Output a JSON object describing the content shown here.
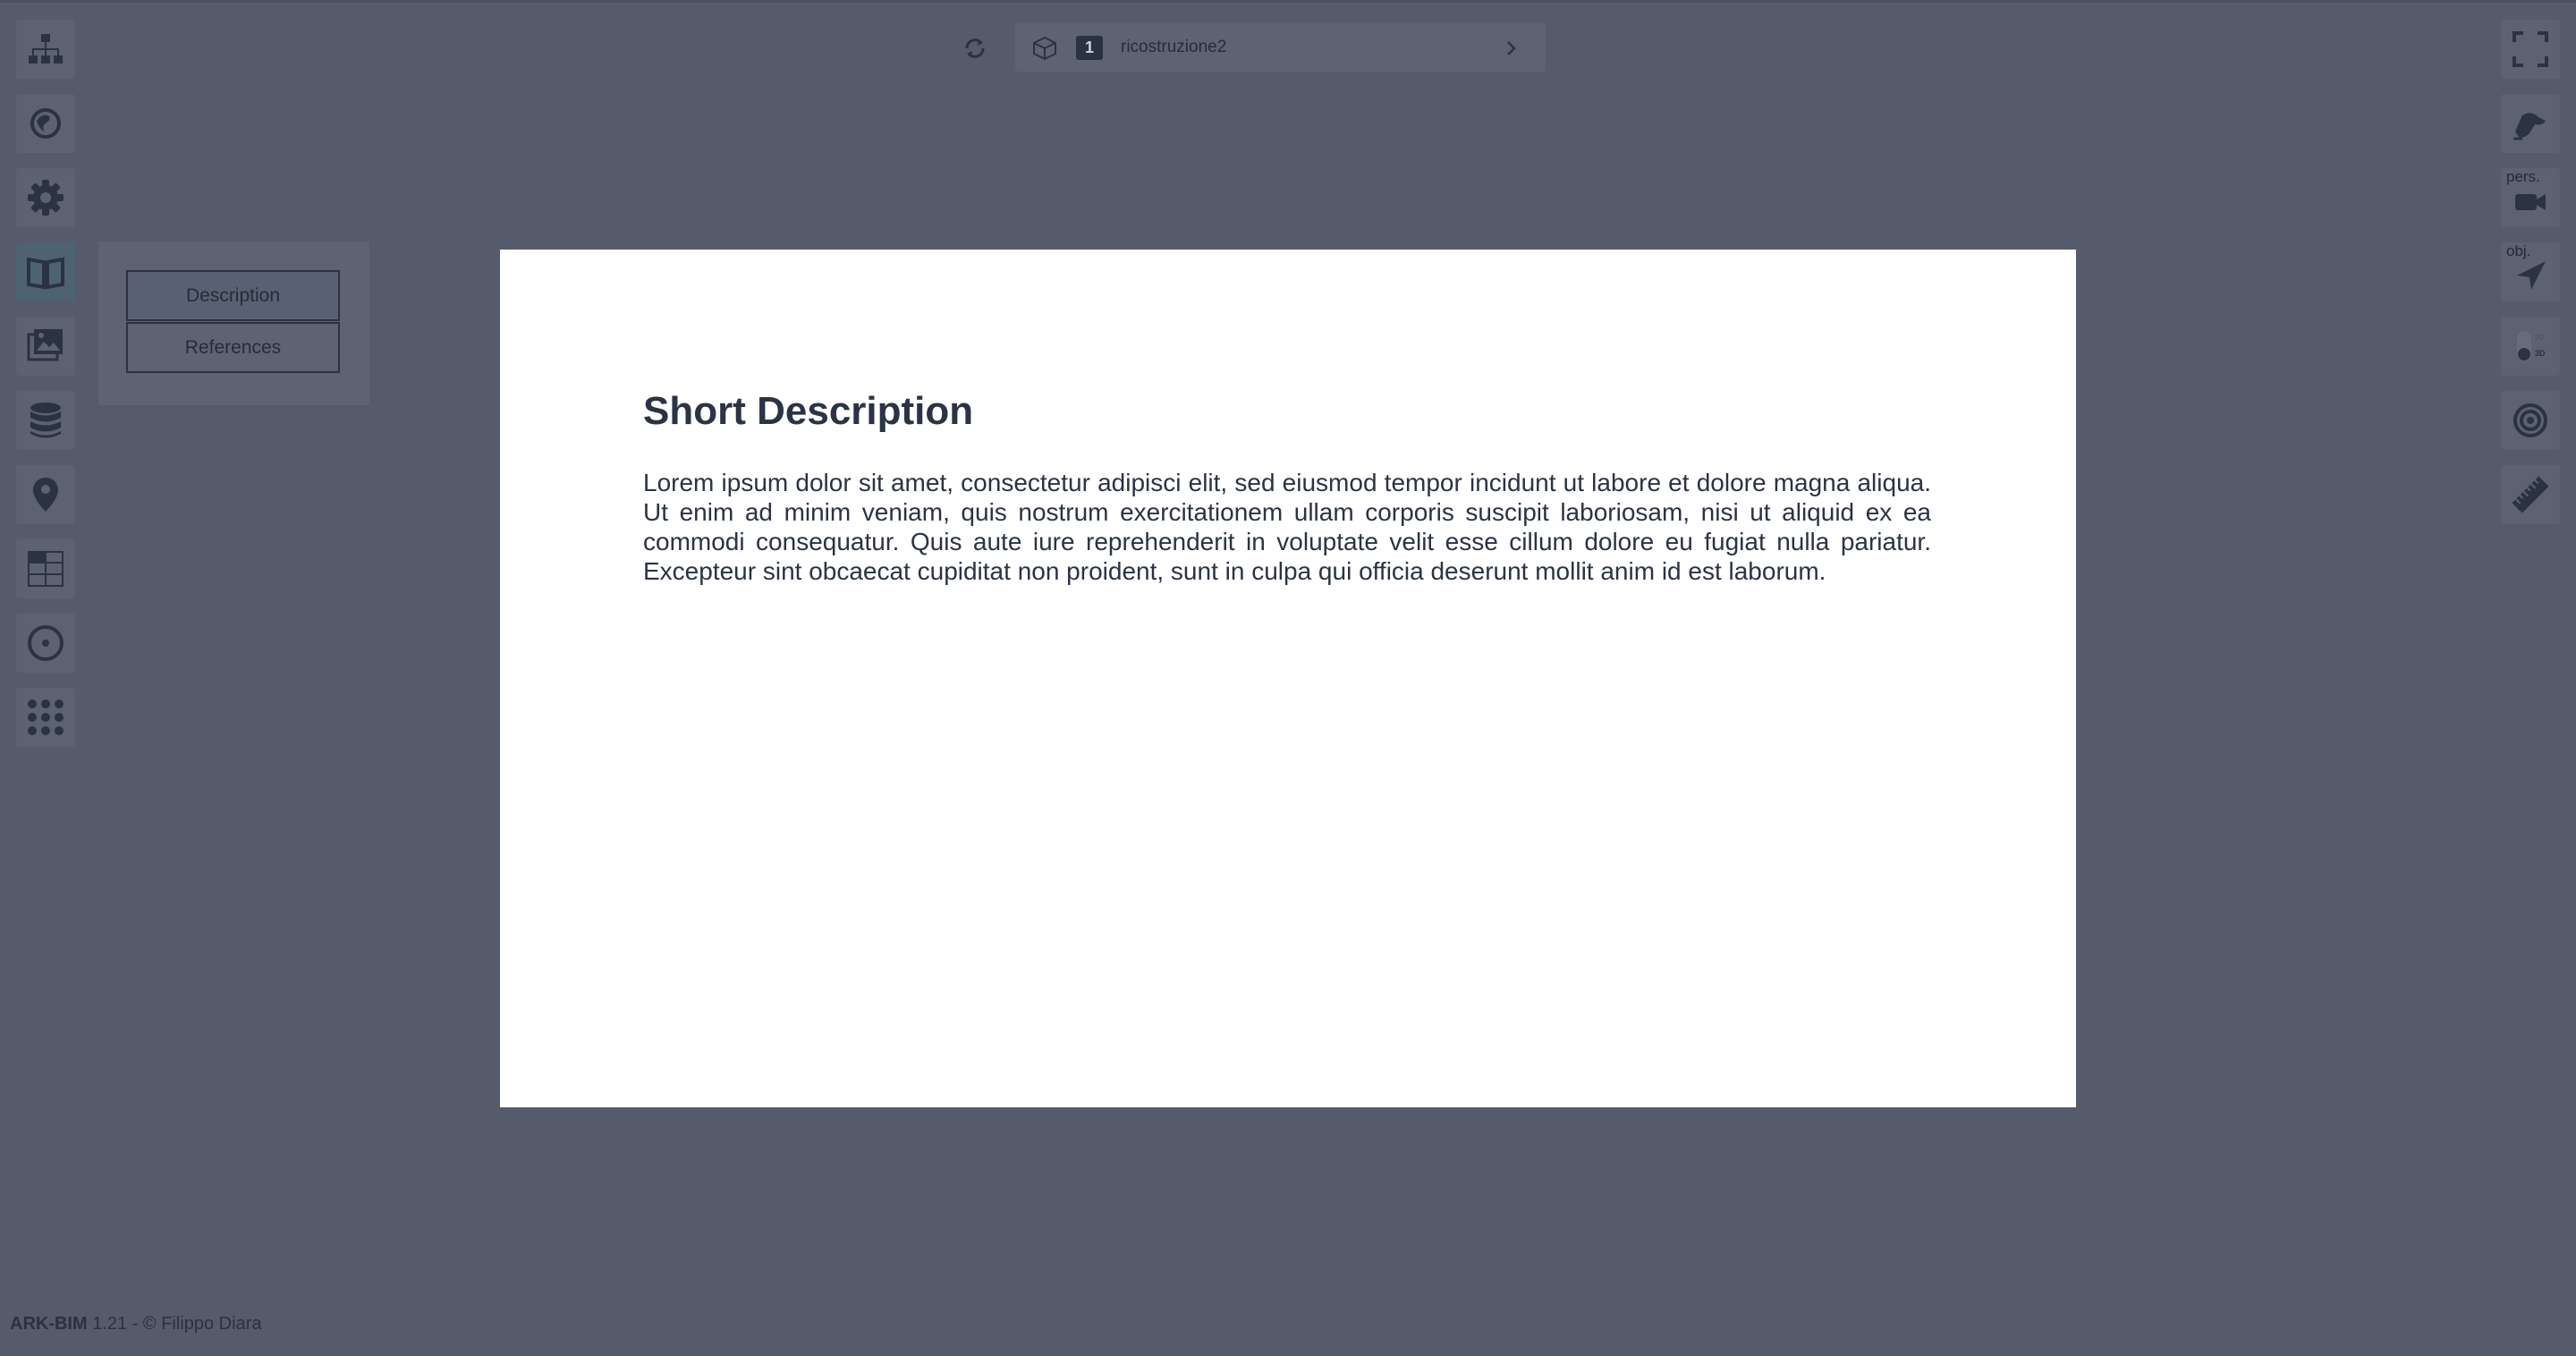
{
  "top_bar": {
    "model_index": "1",
    "model_name": "ricostruzione2"
  },
  "left_toolbar": {
    "items": [
      {
        "icon": "hierarchy-icon"
      },
      {
        "icon": "globe-icon"
      },
      {
        "icon": "gear-icon"
      },
      {
        "icon": "book-icon",
        "active": true
      },
      {
        "icon": "images-icon"
      },
      {
        "icon": "database-icon"
      },
      {
        "icon": "location-pin-icon"
      },
      {
        "icon": "table-icon"
      },
      {
        "icon": "target-dot-icon"
      },
      {
        "icon": "grid-apps-icon"
      }
    ]
  },
  "right_toolbar": {
    "items": [
      {
        "icon": "fullscreen-icon"
      },
      {
        "icon": "hand-icon"
      },
      {
        "icon": "camera-icon",
        "caption": "pers."
      },
      {
        "icon": "navigate-arrow-icon",
        "caption": "obj."
      },
      {
        "icon": "toggle-2d-3d-icon",
        "labels": [
          "2D",
          "3D"
        ]
      },
      {
        "icon": "target-rings-icon"
      },
      {
        "icon": "ruler-icon"
      }
    ]
  },
  "side_panel": {
    "description_label": "Description",
    "references_label": "References"
  },
  "card": {
    "title": "Short Description",
    "body": "Lorem ipsum dolor sit amet, consectetur adipisci elit, sed eiusmod tempor incidunt ut labore et dolore magna aliqua. Ut enim ad minim veniam, quis nostrum exercitationem ullam corporis suscipit laboriosam, nisi ut aliquid ex ea commodi consequatur. Quis aute iure reprehenderit in voluptate velit esse cillum dolore eu fugiat nulla pariatur. Excepteur sint obcaecat cupiditat non proident, sunt in culpa qui officia deserunt mollit anim id est laborum."
  },
  "footer": {
    "app_name": "ARK-BIM",
    "version_credit": " 1.21 - © Filippo Diara"
  },
  "colors": {
    "background": "#555b6a",
    "panel": "#5d6373",
    "icon": "#2b3242",
    "card": "#ffffff",
    "text": "#2b3344"
  }
}
